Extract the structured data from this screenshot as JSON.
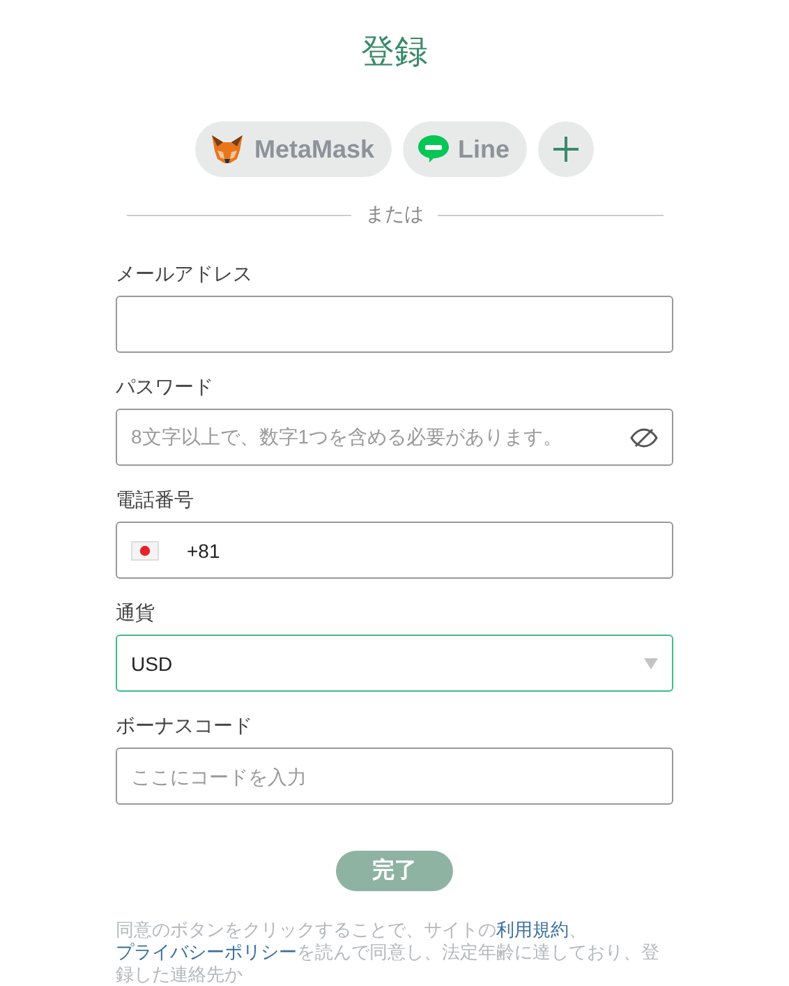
{
  "title": "登録",
  "social": [
    {
      "kind": "metamask",
      "label": "MetaMask"
    },
    {
      "kind": "line",
      "label": "Line"
    },
    {
      "kind": "more"
    }
  ],
  "divider": "または",
  "fields": [
    {
      "kind": "text",
      "label": "メールアドレス",
      "focused": false
    },
    {
      "kind": "password",
      "label": "パスワード",
      "placeholder": "8文字以上で、数字1つを含める必要があります。",
      "focused": false
    },
    {
      "kind": "phone",
      "label": "電話番号",
      "value": "+81",
      "focused": false
    },
    {
      "kind": "select",
      "label": "通貨",
      "value": "USD",
      "focused": true
    },
    {
      "kind": "text",
      "label": "ボーナスコード",
      "placeholder": "ここにコードを入力",
      "focused": false
    }
  ],
  "submit": "完了",
  "terms": [
    {
      "kind": "text",
      "text": "同意のボタンをクリックすることで、サイトの"
    },
    {
      "kind": "link",
      "text": "利用規約"
    },
    {
      "kind": "text",
      "text": "、"
    },
    {
      "kind": "link",
      "text": "プライバシーポリシー"
    },
    {
      "kind": "text",
      "text": "を読んで同意し、法定年齢に達しており、登録した連絡先か"
    }
  ]
}
